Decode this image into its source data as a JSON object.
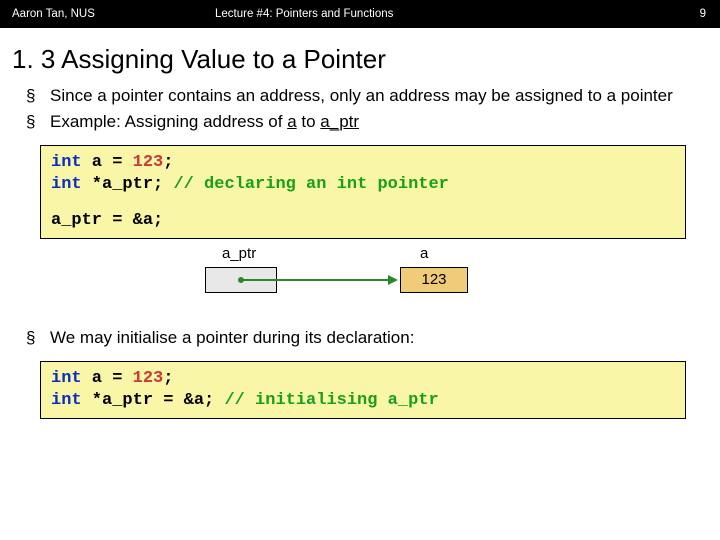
{
  "header": {
    "author": "Aaron Tan, NUS",
    "lecture": "Lecture #4: Pointers and Functions",
    "page": "9"
  },
  "title": "1. 3 Assigning Value to a Pointer",
  "bullets": {
    "b1_a": "Since a pointer contains an address, only an address may be assigned to a pointer",
    "b2_a": "Example: Assigning address of ",
    "b2_b": "a",
    "b2_c": " to ",
    "b2_d": "a_ptr",
    "b3": "We may initialise a pointer during its declaration:"
  },
  "code1": {
    "l1_kw": "int",
    "l1_rest_a": " a = ",
    "l1_num": "123",
    "l1_rest_b": ";",
    "l2_kw": "int",
    "l2_rest": " *a_ptr; ",
    "l2_cm": "// declaring an int pointer",
    "l3": "a_ptr = &a;"
  },
  "diagram": {
    "ptr_label": "a_ptr",
    "var_label": "a",
    "value": "123"
  },
  "code2": {
    "l1_kw": "int",
    "l1_rest_a": " a = ",
    "l1_num": "123",
    "l1_rest_b": ";",
    "l2_kw": "int",
    "l2_rest": " *a_ptr = &a; ",
    "l2_cm": "// initialising a_ptr"
  }
}
